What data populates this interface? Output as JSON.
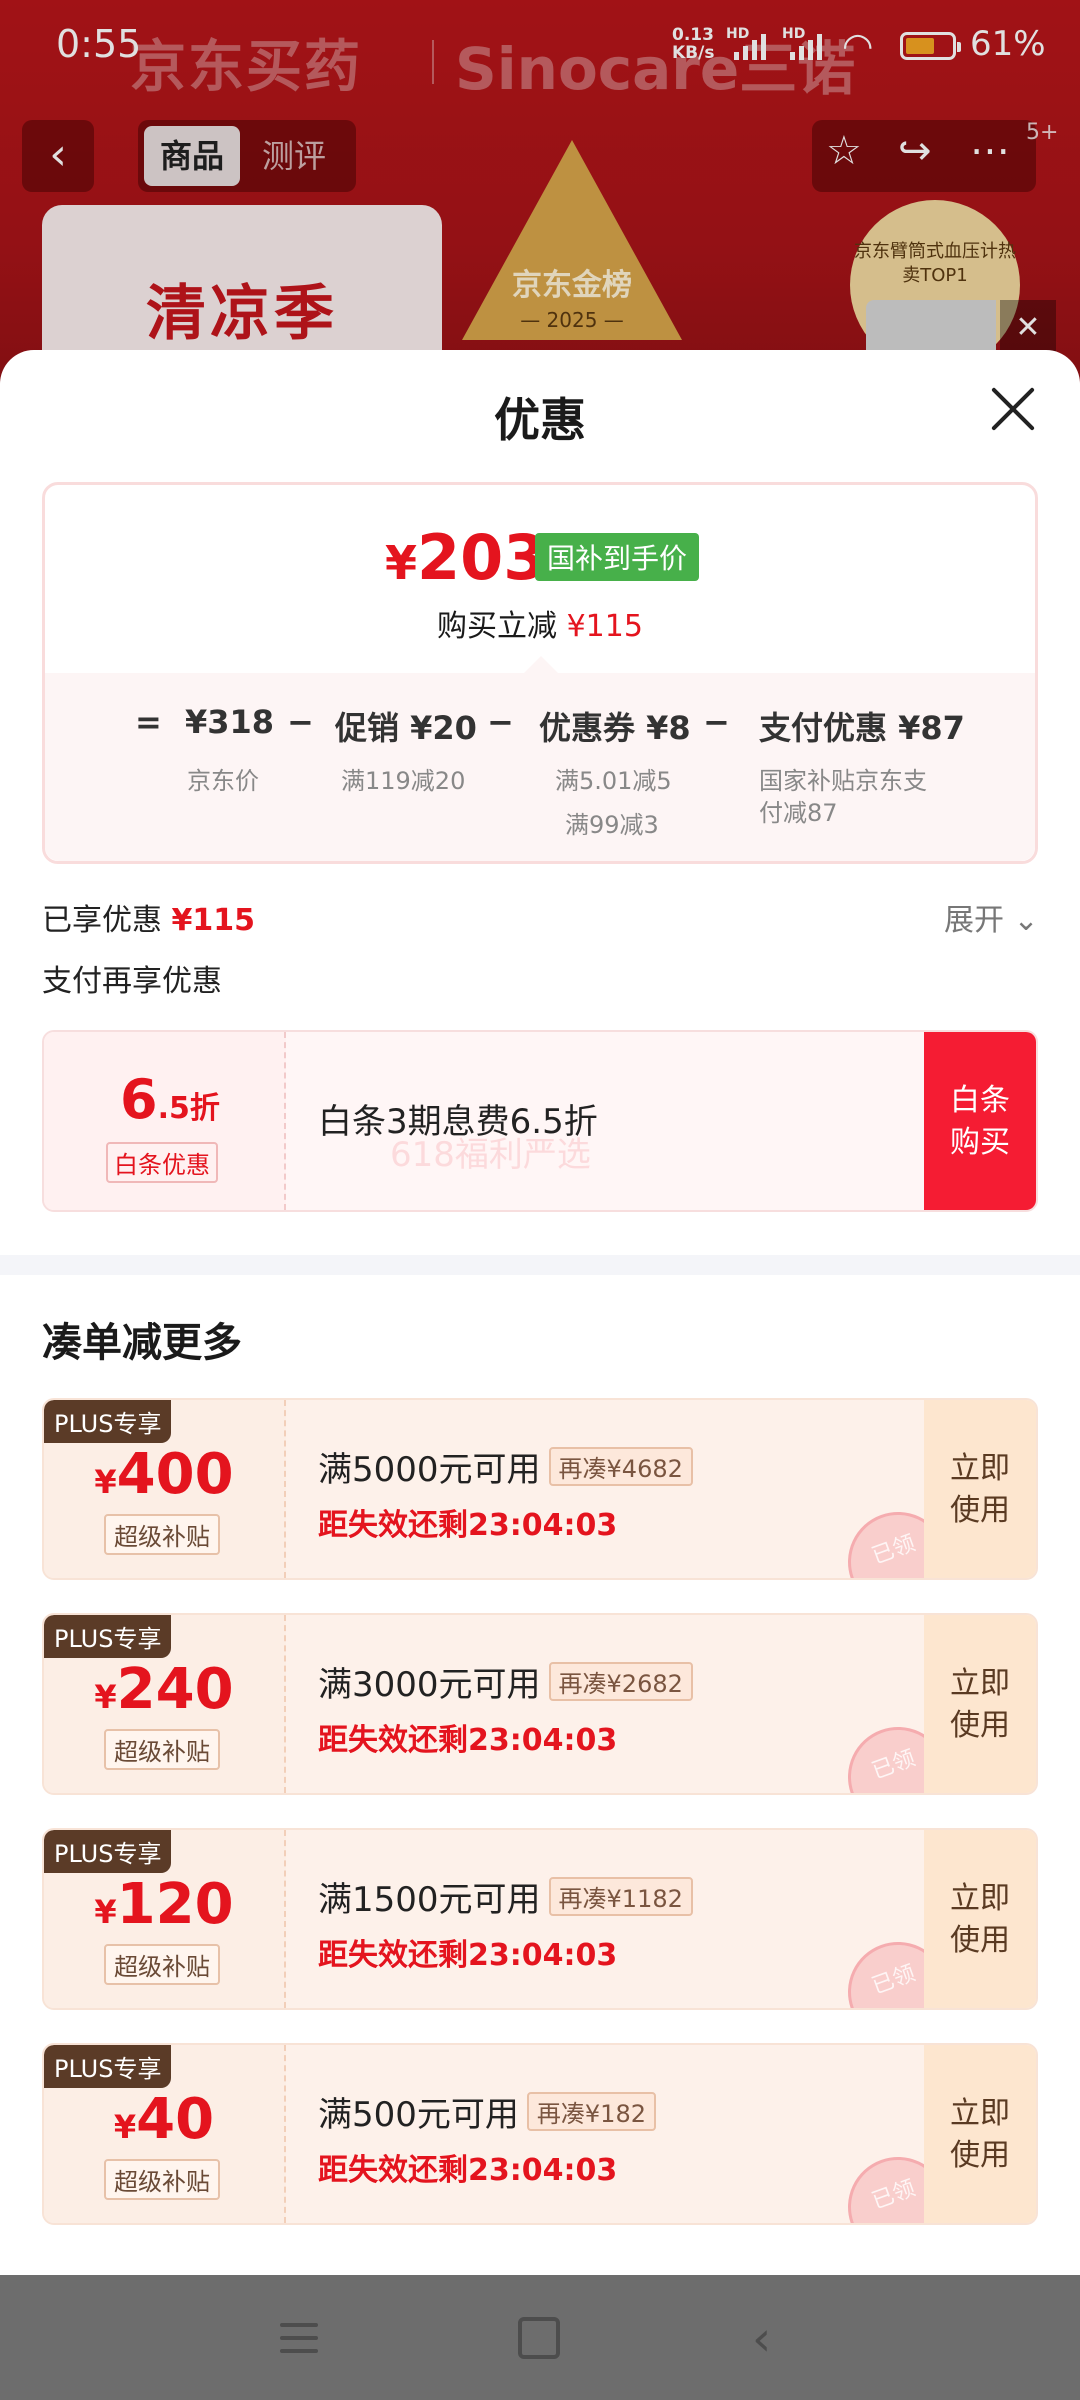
{
  "status_bar": {
    "time": "0:55",
    "net_speed_value": "0.13",
    "net_speed_unit": "KB/s",
    "sim1": "HD",
    "sim2": "HD",
    "battery": "61%",
    "battery_level": 0.61,
    "icons": [
      "signal-icon",
      "signal-icon",
      "wifi-icon",
      "battery-icon"
    ]
  },
  "background_page": {
    "banner_brand": "京东买药",
    "banner_partner": "Sinocare三诺",
    "tabs": [
      "商品",
      "测评"
    ],
    "active_tab": "商品",
    "promo_text": "清凉季",
    "gold_list_title": "京东金榜",
    "gold_list_year": "— 2025 —",
    "medal_text": "京东臂筒式血压计热卖TOP1",
    "notification_badge": "5+",
    "icons": [
      "back-icon",
      "star-icon",
      "share-icon",
      "more-icon",
      "close-icon"
    ]
  },
  "sheet": {
    "title": "优惠",
    "close_icon": "close-icon",
    "summary": {
      "currency": "¥",
      "final_price": "203",
      "final_tag": "国补到手价",
      "reduce_label": "购买立减",
      "reduce_value": "¥115",
      "equals": "=",
      "minus": "−",
      "items": [
        {
          "label": "¥318",
          "desc1": "京东价",
          "desc2": ""
        },
        {
          "label": "促销 ¥20",
          "desc1": "满119减20",
          "desc2": ""
        },
        {
          "label": "优惠券 ¥8",
          "desc1": "满5.01减5",
          "desc2": "满99减3"
        },
        {
          "label": "支付优惠 ¥87",
          "desc1": "国家补贴京东支",
          "desc2": "付减87"
        }
      ]
    },
    "enjoyed_label": "已享优惠",
    "enjoyed_value": "¥115",
    "expand_label": "展开",
    "pay_again_label": "支付再享优惠",
    "baitiao": {
      "discount_big": "6",
      "discount_small": ".5折",
      "tag": "白条优惠",
      "text": "白条3期息费6.5折",
      "watermark": "618福利严选",
      "button_line1": "白条",
      "button_line2": "购买"
    },
    "section_title": "凑单减更多",
    "coupons": [
      {
        "badge": "PLUS专享",
        "currency": "¥",
        "amount": "400",
        "sub": "超级补贴",
        "title": "满5000元可用",
        "extra": "再凑¥4682",
        "countdown": "距失效还剩23:04:03",
        "btn1": "立即",
        "btn2": "使用",
        "stamp": "已领"
      },
      {
        "badge": "PLUS专享",
        "currency": "¥",
        "amount": "240",
        "sub": "超级补贴",
        "title": "满3000元可用",
        "extra": "再凑¥2682",
        "countdown": "距失效还剩23:04:03",
        "btn1": "立即",
        "btn2": "使用",
        "stamp": "已领"
      },
      {
        "badge": "PLUS专享",
        "currency": "¥",
        "amount": "120",
        "sub": "超级补贴",
        "title": "满1500元可用",
        "extra": "再凑¥1182",
        "countdown": "距失效还剩23:04:03",
        "btn1": "立即",
        "btn2": "使用",
        "stamp": "已领"
      },
      {
        "badge": "PLUS专享",
        "currency": "¥",
        "amount": "40",
        "sub": "超级补贴",
        "title": "满500元可用",
        "extra": "再凑¥182",
        "countdown": "距失效还剩23:04:03",
        "btn1": "立即",
        "btn2": "使用",
        "stamp": "已领"
      }
    ]
  },
  "nav_bar": {
    "icons": [
      "menu-icon",
      "home-icon",
      "back-icon"
    ]
  },
  "colors": {
    "accent_red": "#e4141e",
    "green_tag": "#47b04a",
    "header_red": "#b8151a",
    "plus_brown": "#5b3b27"
  }
}
